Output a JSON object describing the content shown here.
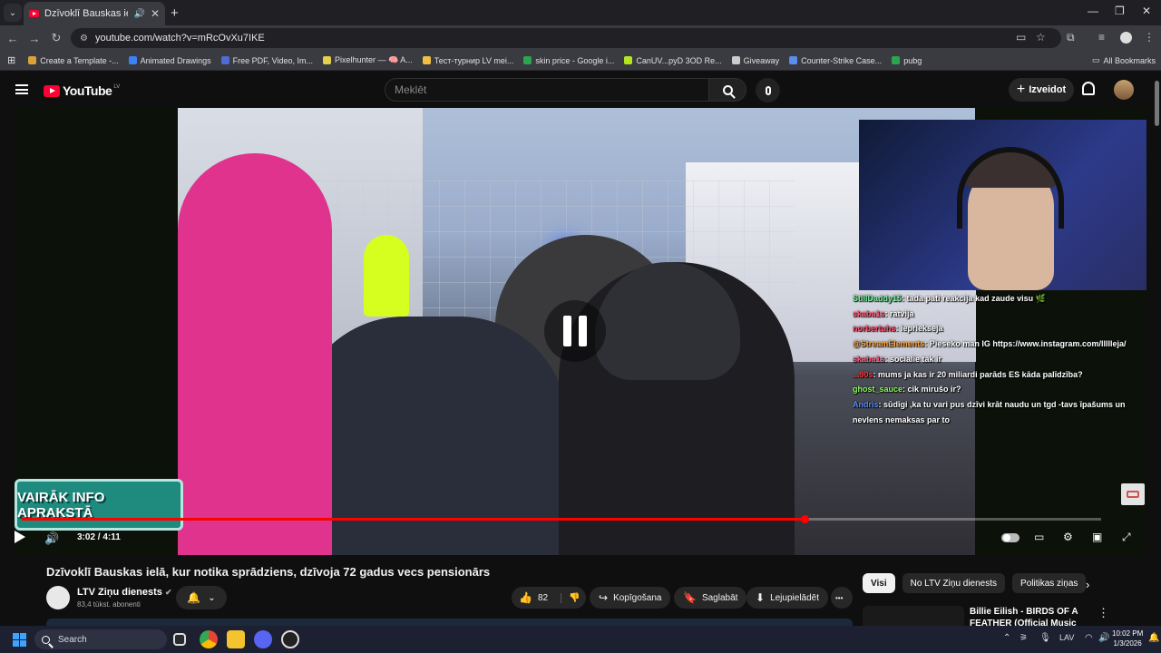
{
  "browser": {
    "tab_title": "Dzīvoklī Bauskas ielā, kur n",
    "tab_audio_icon": "speaker-icon",
    "tab_close": "✕",
    "new_tab": "+",
    "win_min": "—",
    "win_restore": "❐",
    "win_close": "✕",
    "url": "youtube.com/watch?v=mRcOvXu7IKE",
    "bookmarks": [
      {
        "label": "Create a Template -...",
        "color": "#d9a13a"
      },
      {
        "label": "Animated Drawings",
        "color": "#3b82f6"
      },
      {
        "label": "Free PDF, Video, Im...",
        "color": "#4f6bd6"
      },
      {
        "label": "Pixelhunter — 🧠 A...",
        "color": "#e3d04a"
      },
      {
        "label": "Тест-турнир LV mei...",
        "color": "#f0c040"
      },
      {
        "label": "skin price - Google i...",
        "color": "#2ea44f"
      },
      {
        "label": "CanUV...pyD 3OD Re...",
        "color": "#b5e61d"
      },
      {
        "label": "Giveaway",
        "color": "#cccccc"
      },
      {
        "label": "Counter-Strike Case...",
        "color": "#5b8def"
      },
      {
        "label": "pubg",
        "color": "#2ea44f"
      }
    ],
    "all_bookmarks": "All Bookmarks"
  },
  "youtube": {
    "logo_text": "YouTube",
    "logo_country": "LV",
    "search_placeholder": "Meklēt",
    "create_label": "Izveidot"
  },
  "player": {
    "time": "3:02 / 4:11",
    "progress_fraction": 0.725,
    "info_badge": "VAIRĀK INFO APRAKSTĀ",
    "chat": [
      {
        "user": "StillDaddy15",
        "msg": ": tada pati reakcija kad zaude visu 🌿",
        "color": "#7cf0a0"
      },
      {
        "user": "skaba1s",
        "msg": ": ratvija",
        "color": "#ff5a7a"
      },
      {
        "user": "norbertuhs",
        "msg": ": iepriekseja",
        "color": "#ff4d6d"
      },
      {
        "user": "@StreamElements",
        "msg": ": Pieseko man IG https://www.instagram.com/llllleja/",
        "color": "#ffa640"
      },
      {
        "user": "skaba1s",
        "msg": ": socialie tak ir",
        "color": "#ff5a7a"
      },
      {
        "user": "...90s",
        "msg": ": mums ja kas ir 20 miliardi parāds ES kāda palīdzība?",
        "color": "#ff3b3b"
      },
      {
        "user": "ghost_sauce",
        "msg": ": cik mirušo ir?",
        "color": "#8dff5a"
      },
      {
        "user": "Andris",
        "msg": ": sūdīgi ,ka tu vari pus dzīvi krāt naudu un tgd -tavs īpašums un nevlens nemaksas par to",
        "color": "#5a8dff"
      }
    ]
  },
  "video": {
    "title": "Dzīvoklī Bauskas ielā, kur notika sprādziens, dzīvoja 72 gadus vecs pensionārs",
    "channel": "LTV Ziņu dienests",
    "subs": "83,4 tūkst. abonenti",
    "likes": "82",
    "share": "Kopīgošana",
    "save": "Saglabāt",
    "download": "Lejupielādēt",
    "more": "•••"
  },
  "sidebar": {
    "chips": [
      "Visi",
      "No LTV Ziņu dienests",
      "Politikas ziņas"
    ],
    "next": "›",
    "related_title": "Billie Eilish - BIRDS OF A FEATHER (Official Music Video)",
    "related_more": "⋮"
  },
  "taskbar": {
    "search": "Search",
    "lang": "LAV",
    "time": "10:02 PM",
    "date": "1/3/2026"
  },
  "colors": {
    "accent_red": "#ff0000",
    "yt_bg": "#0f0f0f",
    "badge_teal": "#1f8a7e"
  }
}
